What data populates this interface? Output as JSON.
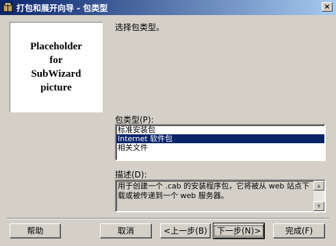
{
  "window": {
    "title": "打包和展开向导 - 包类型",
    "close_glyph": "×"
  },
  "picture_text": "Placeholder\nfor\nSubWizard\npicture",
  "instruction": "选择包类型。",
  "package_type": {
    "label": "包类型(P):",
    "items": [
      "标准安装包",
      "Internet 软件包",
      "相关文件"
    ],
    "selected_index": 1
  },
  "description": {
    "label": "描述(D):",
    "text": "用于创建一个 .cab 的安装程序包，它将被从 web 站点下载或被传递到一个 web 服务器。"
  },
  "buttons": {
    "help": "帮助",
    "cancel": "取消",
    "back": "<上一步(B)",
    "next": "下一步(N)>",
    "finish": "完成(F)"
  }
}
